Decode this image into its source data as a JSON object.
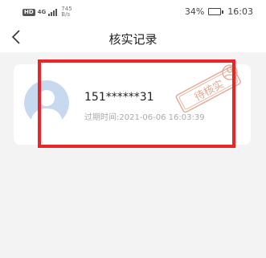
{
  "status_bar": {
    "hd": "HD",
    "network": "4G",
    "speed_value": "745",
    "speed_unit": "B/s",
    "battery": "34%",
    "battery_level": 0.34,
    "time": "16:03"
  },
  "header": {
    "title": "核实记录",
    "back_icon": "chevron-left-icon"
  },
  "record": {
    "phone": "151******31",
    "expire_label": "过期时间:",
    "expire_time": "2021-06-06 16:03:39",
    "stamp_text": "待核实",
    "avatar_icon": "user-avatar-icon"
  },
  "colors": {
    "highlight": "#e8262a",
    "stamp": "#e4a78f",
    "avatar_bg": "#c6d9ef"
  }
}
